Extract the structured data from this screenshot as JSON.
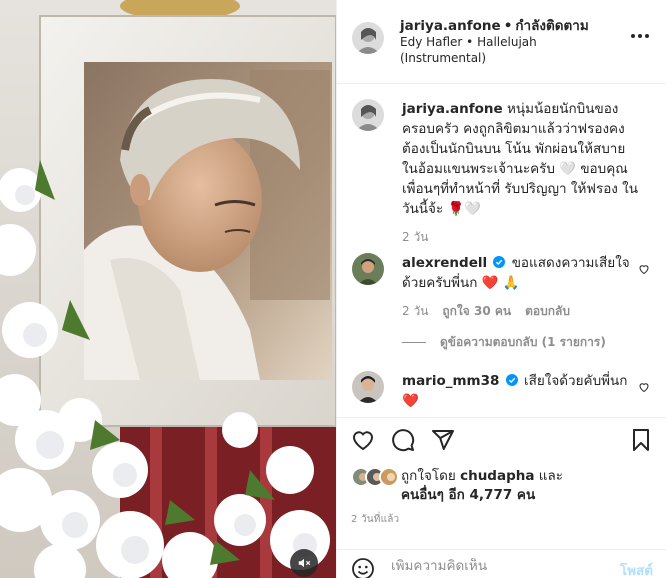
{
  "header": {
    "username": "jariya.anfone",
    "separator": "•",
    "follow_status": "กำลังติดตาม",
    "audio": "Edy Hafler • Hallelujah (Instrumental)",
    "more_icon": "more-horizontal-icon"
  },
  "caption": {
    "username": "jariya.anfone",
    "text": "หนุ่มน้อยนักบินของครอบครัว คงถูกลิขิตมาแล้วว่าฟรองคงต้องเป็นนักบินบน โน้น พักผ่อนให้สบาย ในอ้อมแขนพระเจ้านะครับ 🤍 ขอบคุณเพื่อนๆที่ทำหน้าที่ รับปริญญา ให้ฟรอง ในวันนี้จ้ะ 🌹🤍",
    "time": "2 วัน"
  },
  "comments": [
    {
      "username": "alexrendell",
      "verified": true,
      "text": "ขอแสดงความเสียใจด้วยครับพี่นก ❤️ 🙏",
      "time": "2 วัน",
      "likes": "ถูกใจ 30 คน",
      "reply": "ตอบกลับ"
    },
    {
      "username": "mario_mm38",
      "verified": true,
      "text": "เสียใจด้วยคับพี่นก❤️"
    }
  ],
  "view_replies": "ดูข้อความตอบกลับ (1 รายการ)",
  "likes_summary": {
    "prefix": "ถูกใจโดย",
    "user": "chudapha",
    "middle": "และ",
    "others": "คนอื่นๆ อีก 4,777 คน"
  },
  "time_ago": "2 วันที่แล้ว",
  "comment_box": {
    "placeholder": "เพิ่มความคิดเห็น",
    "post_label": "โพสต์"
  },
  "colors": {
    "accent": "#0095f6",
    "post_disabled": "#b2dffc",
    "heart_red": "#ed4956",
    "muted": "#8e8e8e"
  }
}
